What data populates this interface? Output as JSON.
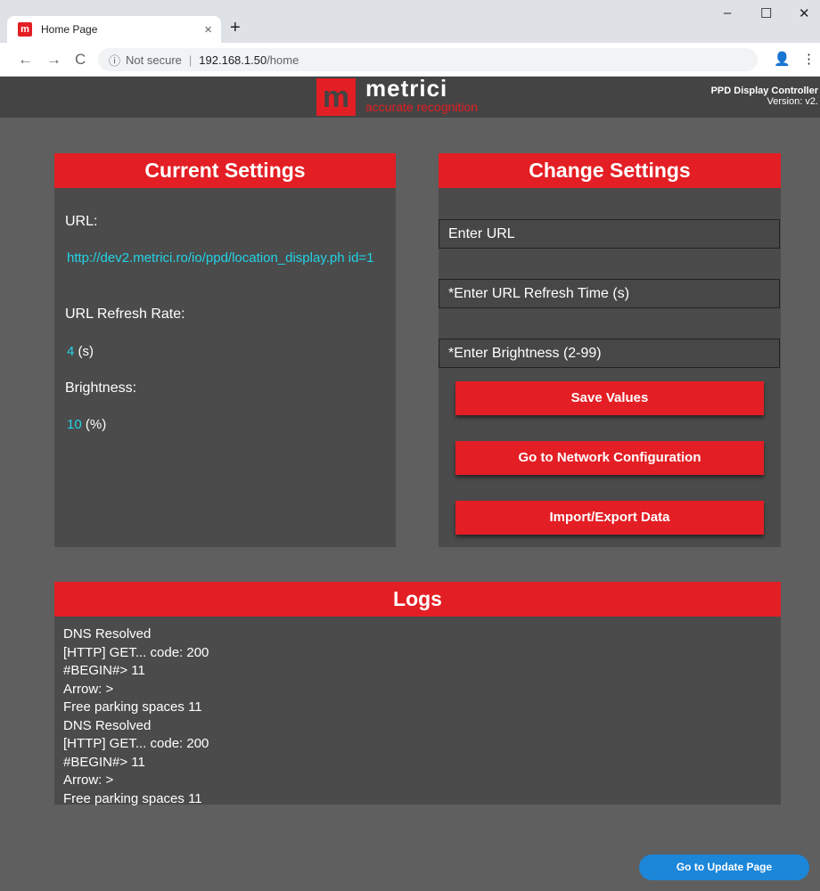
{
  "browser": {
    "tab_title": "Home Page",
    "tab_close": "×",
    "new_tab": "+",
    "minimize": "–",
    "maximize": "☐",
    "close": "✕",
    "back": "←",
    "forward": "→",
    "reload": "C",
    "info_icon": "ⓘ",
    "security": "Not secure",
    "url_host": "192.168.1.50",
    "url_path": "/home",
    "profile": "👤",
    "menu": "⋮"
  },
  "header": {
    "logo_mark": "m",
    "brand": "metrici",
    "tagline": "accurate recognition",
    "product": "PPD Display Controller",
    "version": "Version: v2."
  },
  "current": {
    "title": "Current Settings",
    "url_label": "URL:",
    "url_value": "http://dev2.metrici.ro/io/ppd/location_display.ph id=1",
    "refresh_label": "URL Refresh Rate:",
    "refresh_value": "4",
    "refresh_unit": "(s)",
    "brightness_label": "Brightness:",
    "brightness_value": "10",
    "brightness_unit": "(%)"
  },
  "change": {
    "title": "Change Settings",
    "url_placeholder": "Enter URL",
    "refresh_placeholder": "*Enter URL Refresh Time (s)",
    "brightness_placeholder": "*Enter Brightness (2-99)",
    "save_label": "Save Values",
    "network_label": "Go to Network Configuration",
    "import_label": "Import/Export Data"
  },
  "logs": {
    "title": "Logs",
    "lines": [
      "DNS Resolved",
      "[HTTP] GET... code: 200",
      "#BEGIN#> 11",
      "Arrow: >",
      "Free parking spaces 11",
      "DNS Resolved",
      "[HTTP] GET... code: 200",
      "#BEGIN#> 11",
      "Arrow: >",
      "Free parking spaces 11"
    ]
  },
  "update_label": "Go to Update Page"
}
